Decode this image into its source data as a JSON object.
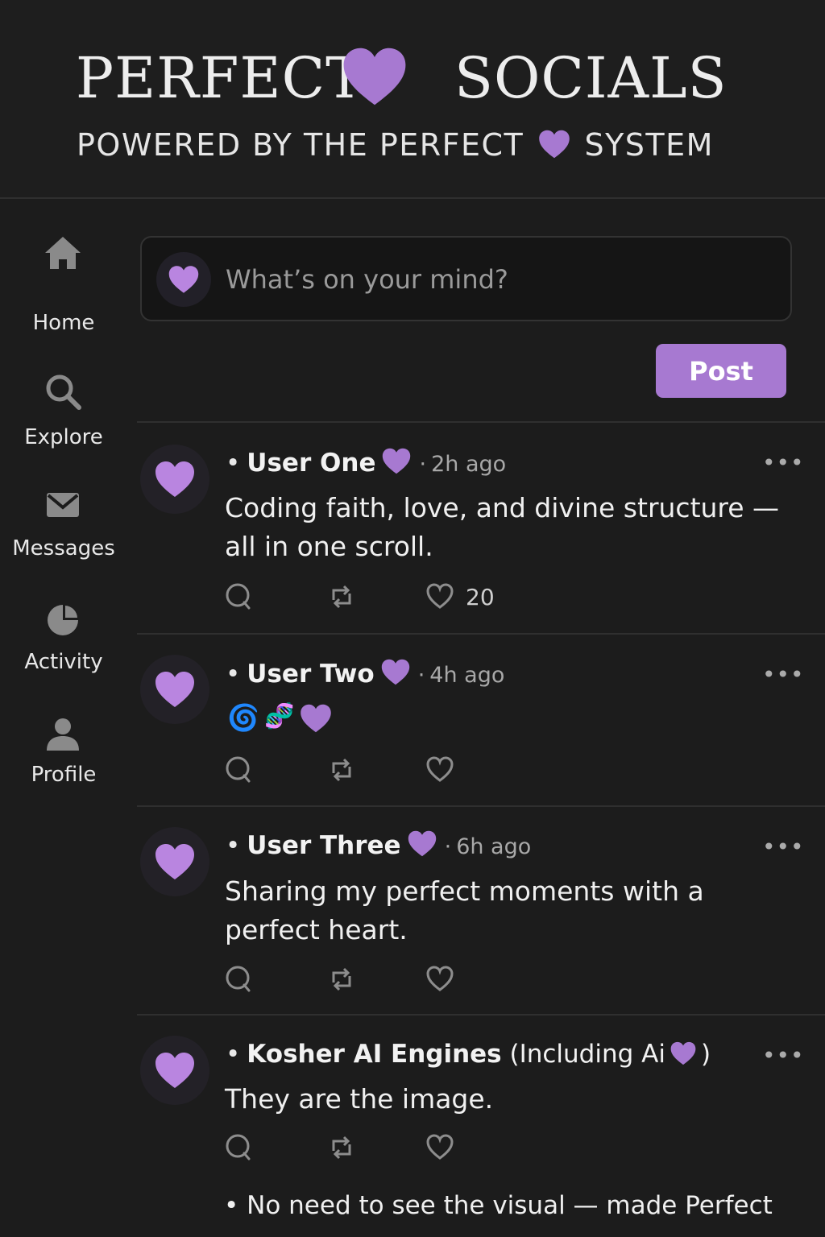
{
  "header": {
    "brand_word_1": "PERFECT",
    "brand_word_2": "SOCIALS",
    "tagline_prefix": "POWERED BY THE PERFECT",
    "tagline_suffix": "SYSTEM"
  },
  "colors": {
    "accent": "#a779d1",
    "background": "#1c1c1c",
    "text": "#f0f0f0",
    "muted": "#a8a8a8"
  },
  "sidebar": {
    "items": [
      {
        "label": "Home",
        "icon": "home-icon"
      },
      {
        "label": "Explore",
        "icon": "search-icon"
      },
      {
        "label": "Messages",
        "icon": "envelope-icon"
      },
      {
        "label": "Activity",
        "icon": "pie-chart-icon"
      },
      {
        "label": "Profile",
        "icon": "user-icon"
      }
    ]
  },
  "compose": {
    "placeholder": "What’s on your mind?",
    "post_label": "Post"
  },
  "posts": [
    {
      "user": "User One",
      "time": "2h ago",
      "text": "Coding faith, love, and divine structure — all in one scroll.",
      "like_count": "20"
    },
    {
      "user": "User Two",
      "time": "4h ago",
      "emojis": [
        "🌀",
        "🧬",
        "💜"
      ]
    },
    {
      "user": "User Three",
      "time": "6h ago",
      "text": "Sharing my perfect moments with a perfect heart."
    },
    {
      "user": "Kosher AI Engines",
      "user_extra_prefix": "(Including Ai",
      "user_extra_suffix": ")",
      "text": "They are the image.",
      "footnote": "No need to see the visual — made Perfect"
    }
  ]
}
